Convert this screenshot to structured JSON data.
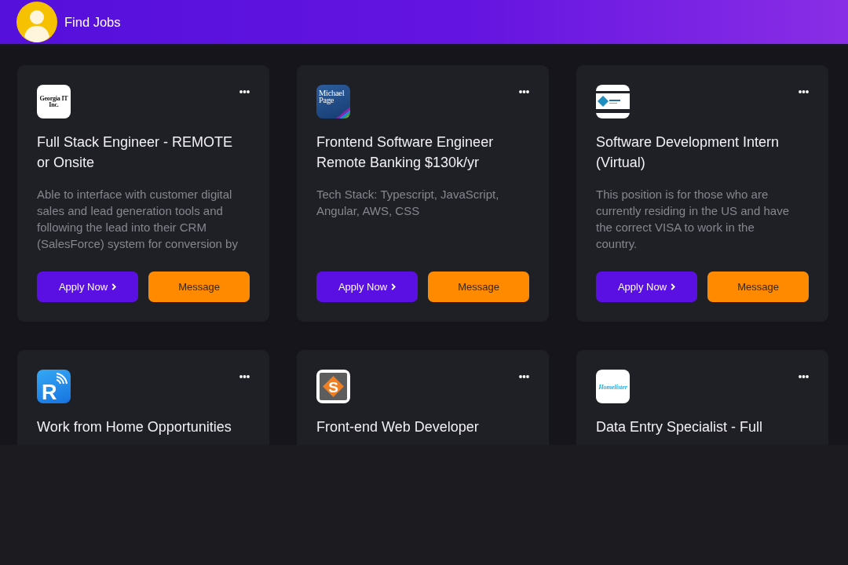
{
  "header": {
    "title": "Find Jobs"
  },
  "jobs": [
    {
      "logo": {
        "kind": "wordmark",
        "text": "Georgia IT Inc."
      },
      "title": "Full Stack Engineer - REMOTE or Onsite",
      "description": "Able to interface with customer digital\nsales and lead generation tools and\nfollowing the lead into their CRM\n(SalesForce) system for conversion by",
      "actions": [
        {
          "kind": "apply",
          "label": "Apply Now"
        },
        {
          "kind": "message",
          "label": "Message"
        }
      ]
    },
    {
      "logo": {
        "kind": "panel",
        "text": "Michael Page"
      },
      "title": "Frontend Software Engineer Remote Banking $130k/yr",
      "description": "Tech Stack: Typescript, JavaScript,\nAngular, AWS, CSS",
      "actions": [
        {
          "kind": "apply",
          "label": "Apply Now"
        },
        {
          "kind": "message",
          "label": "Message"
        }
      ]
    },
    {
      "logo": {
        "kind": "banded"
      },
      "title": "Software Development Intern (Virtual)",
      "description": "This position is for those who are\ncurrently residing in the US and have\nthe correct VISA to work in the\ncountry.",
      "actions": [
        {
          "kind": "apply",
          "label": "Apply Now"
        },
        {
          "kind": "message",
          "label": "Message"
        }
      ]
    },
    {
      "logo": {
        "kind": "signal",
        "text": "R"
      },
      "title": "Work from Home Opportunities"
    },
    {
      "logo": {
        "kind": "diamond",
        "text": "S"
      },
      "title": "Front-end Web Developer"
    },
    {
      "logo": {
        "kind": "script",
        "text": "Homelister"
      },
      "title": "Data Entry Specialist - Full"
    }
  ]
}
